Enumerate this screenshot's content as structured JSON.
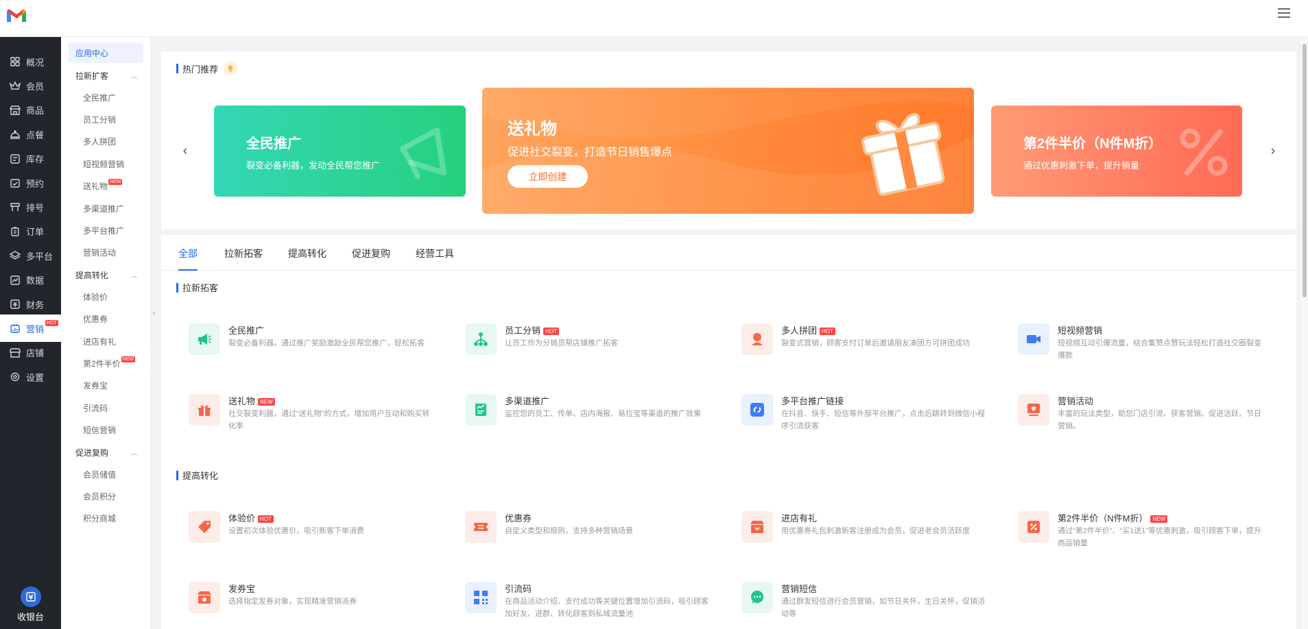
{
  "sidebar_main": {
    "items": [
      {
        "label": "概况",
        "icon": "grid-icon"
      },
      {
        "label": "会员",
        "icon": "crown-icon"
      },
      {
        "label": "商品",
        "icon": "store-icon"
      },
      {
        "label": "点餐",
        "icon": "cloche-icon"
      },
      {
        "label": "库存",
        "icon": "inventory-icon"
      },
      {
        "label": "预约",
        "icon": "calendar-check-icon"
      },
      {
        "label": "排号",
        "icon": "queue-icon"
      },
      {
        "label": "订单",
        "icon": "order-icon"
      },
      {
        "label": "多平台",
        "icon": "layers-icon"
      },
      {
        "label": "数据",
        "icon": "chart-icon"
      },
      {
        "label": "财务",
        "icon": "finance-icon"
      },
      {
        "label": "营销",
        "icon": "marketing-icon",
        "badge": "HOT"
      },
      {
        "label": "店铺",
        "icon": "shop-icon"
      },
      {
        "label": "设置",
        "icon": "settings-icon"
      }
    ],
    "cashier_label": "收银台"
  },
  "sidebar_sub": {
    "app_center": "应用中心",
    "groups": [
      {
        "title": "拉新扩客",
        "items": [
          "全民推广",
          "员工分销",
          "多人拼团",
          "短视频营销",
          "送礼物",
          "多渠道推广",
          "多平台推广",
          "营销活动"
        ]
      },
      {
        "title": "提高转化",
        "items": [
          "体验价",
          "优惠券",
          "进店有礼",
          "第2件半价",
          "发券宝",
          "引流码",
          "短信营销"
        ]
      },
      {
        "title": "促进复购",
        "items": [
          "会员储值",
          "会员积分",
          "积分商城"
        ]
      }
    ],
    "new_tag": "NEW"
  },
  "hot": {
    "title": "热门推荐",
    "banners": [
      {
        "title": "全民推广",
        "subtitle": "裂变必备利器，发动全民帮您推广"
      },
      {
        "title": "送礼物",
        "subtitle": "促进社交裂变，打造节日销售爆点",
        "cta": "立即创建"
      },
      {
        "title": "第2件半价（N件M折）",
        "subtitle": "通过优惠刺激下单，提升销量"
      }
    ]
  },
  "tabs": [
    "全部",
    "拉新拓客",
    "提高转化",
    "促进复购",
    "经营工具"
  ],
  "sections": [
    {
      "title": "拉新拓客",
      "cards": [
        {
          "name": "全民推广",
          "desc": "裂变必备利器。通过推广奖励激励全民帮您推广，轻松拓客",
          "icon": "megaphone-icon",
          "color": "#1fc48d",
          "bg": "#e6f8f1"
        },
        {
          "name": "员工分销",
          "tag": "HOT",
          "desc": "让员工作为分销员帮店铺推广拓客",
          "icon": "org-tree-icon",
          "color": "#1fc48d",
          "bg": "#e6f8f1"
        },
        {
          "name": "多人拼团",
          "tag": "HOT",
          "desc": "裂变式营销，顾客支付订单后邀请朋友凑团方可拼团成功",
          "icon": "group-icon",
          "color": "#f5674a",
          "bg": "#fdece8"
        },
        {
          "name": "短视频营销",
          "desc": "短视频互动引爆流量，结合集赞点赞玩法轻松打造社交圈裂变爆款",
          "icon": "video-icon",
          "color": "#3f7cf5",
          "bg": "#e9f0fe"
        },
        {
          "name": "送礼物",
          "tag": "NEW",
          "desc": "社交裂变利器，通过“送礼物”的方式，增加用户互动和购买转化率",
          "icon": "gift-icon",
          "color": "#f5674a",
          "bg": "#fdece8"
        },
        {
          "name": "多渠道推广",
          "desc": "监控您的员工、传单、店内海报、易拉宝等渠道的推广效果",
          "icon": "channel-icon",
          "color": "#1fc48d",
          "bg": "#e6f8f1"
        },
        {
          "name": "多平台推广链接",
          "desc": "在抖音、快手、短信等外部平台推广，点击后跳转到微信小程序引流获客",
          "icon": "link-icon",
          "color": "#3f7cf5",
          "bg": "#e9f0fe"
        },
        {
          "name": "营销活动",
          "desc": "丰富的玩法类型，助您门店引流、获客营销、促进活跃、节日营销。",
          "icon": "activity-icon",
          "color": "#f5674a",
          "bg": "#fdece8"
        }
      ]
    },
    {
      "title": "提高转化",
      "cards": [
        {
          "name": "体验价",
          "tag": "HOT",
          "desc": "设置初次体验优惠价，吸引新客下单消费",
          "icon": "price-tag-icon",
          "color": "#f5674a",
          "bg": "#fdece8"
        },
        {
          "name": "优惠券",
          "desc": "自定义类型和规则，支持多种营销场景",
          "icon": "coupon-icon",
          "color": "#f5674a",
          "bg": "#fdece8"
        },
        {
          "name": "进店有礼",
          "desc": "用优惠券礼包刺激新客注册成为会员，促进老会员活跃度",
          "icon": "welcome-gift-icon",
          "color": "#f5674a",
          "bg": "#fdece8"
        },
        {
          "name": "第2件半价（N件M折）",
          "tag": "NEW",
          "desc": "通过“第2件半价”、“买1送1”等优惠刺激，吸引顾客下单，提升商品销量",
          "icon": "discount-icon",
          "color": "#f5674a",
          "bg": "#fdece8"
        },
        {
          "name": "发券宝",
          "desc": "选择指定发券对象，实现精准营销派券",
          "icon": "coupon-sender-icon",
          "color": "#f5674a",
          "bg": "#fdece8"
        },
        {
          "name": "引流码",
          "desc": "在商品活动介绍、支付成功等关键位置增加引流码，吸引顾客加好友、进群、转化顾客到私域流量池",
          "icon": "qrcode-icon",
          "color": "#3f7cf5",
          "bg": "#e9f0fe"
        },
        {
          "name": "营销短信",
          "desc": "通过群发短信进行会员营销，如节日关怀，生日关怀，促销活动等",
          "icon": "sms-icon",
          "color": "#1fc48d",
          "bg": "#e6f8f1"
        }
      ]
    }
  ]
}
